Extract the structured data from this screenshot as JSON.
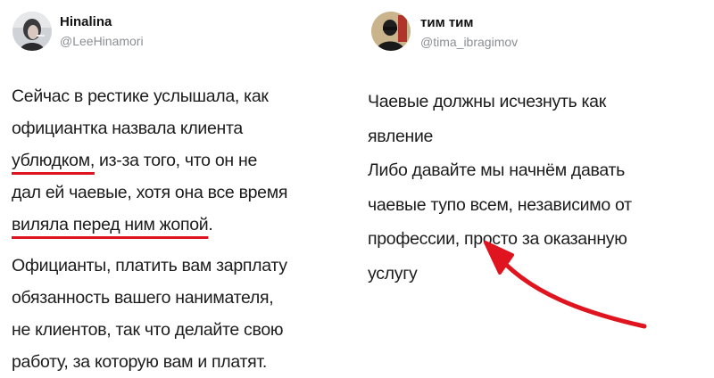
{
  "tweets": [
    {
      "author": {
        "name": "Hinalina",
        "handle": "@LeeHinamori"
      },
      "paragraphs": [
        {
          "lines": [
            [
              "Сейчас в рестике услышала, как"
            ],
            [
              "официантка назвала клиента"
            ],
            [
              "ублюдком,",
              " из-за того, что он не"
            ],
            [
              "дал ей чаевые, хотя она все время"
            ],
            [
              "виляла перед ним жопой",
              "."
            ]
          ]
        },
        {
          "lines": [
            [
              "Официанты, платить вам зарплату"
            ],
            [
              "обязанность вашего нанимателя,"
            ],
            [
              "не клиентов, так что делайте свою"
            ],
            [
              "работу, за которую вам и платят."
            ]
          ]
        }
      ]
    },
    {
      "author": {
        "name": "тим тим",
        "handle": "@tima_ibragimov"
      },
      "paragraphs": [
        {
          "lines": [
            [
              "Чаевые должны исчезнуть как"
            ],
            [
              "явление"
            ]
          ]
        },
        {
          "lines": [
            [
              "Либо давайте мы начнём давать"
            ],
            [
              "чаевые тупо всем, независимо от"
            ],
            [
              "профессии, просто за оказанную"
            ],
            [
              "услугу"
            ]
          ]
        }
      ]
    }
  ],
  "colors": {
    "highlight": "#e0141e",
    "handle": "#8a8f94"
  }
}
